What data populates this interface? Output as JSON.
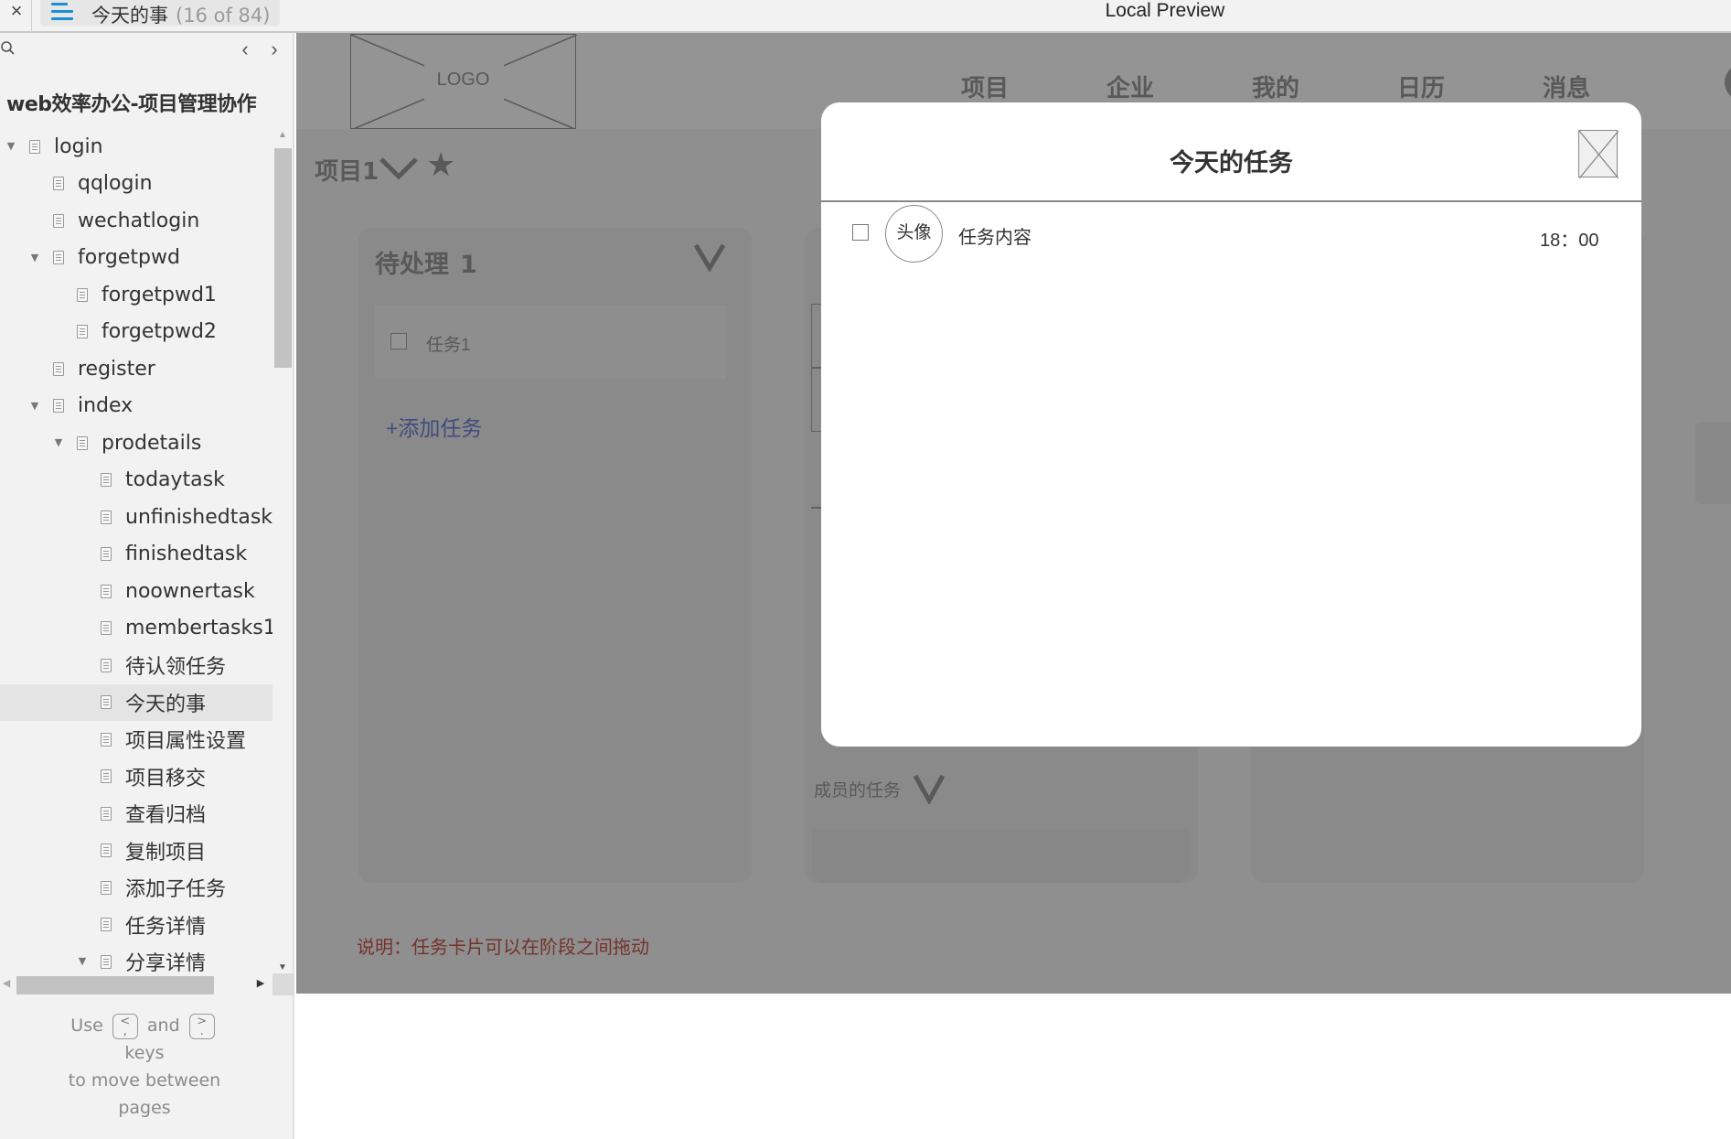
{
  "window": {
    "close_label": "×",
    "current_page": "今天的事",
    "page_count": "(16 of 84)",
    "title": "Local Preview"
  },
  "sidebar": {
    "project_title": "web效率办公-项目管理协作",
    "prev_label": "‹",
    "next_label": "›",
    "tree": [
      {
        "label": "login",
        "level": 0,
        "expanded": true
      },
      {
        "label": "qqlogin",
        "level": 1
      },
      {
        "label": "wechatlogin",
        "level": 1
      },
      {
        "label": "forgetpwd",
        "level": 1,
        "expanded": true
      },
      {
        "label": "forgetpwd1",
        "level": 2
      },
      {
        "label": "forgetpwd2",
        "level": 2
      },
      {
        "label": "register",
        "level": 1
      },
      {
        "label": "index",
        "level": 1,
        "expanded": true
      },
      {
        "label": "prodetails",
        "level": 2,
        "expanded": true
      },
      {
        "label": "todaytask",
        "level": 3
      },
      {
        "label": "unfinishedtask",
        "level": 3
      },
      {
        "label": "finishedtask",
        "level": 3
      },
      {
        "label": "noownertask",
        "level": 3
      },
      {
        "label": "membertasks1",
        "level": 3
      },
      {
        "label": "待认领任务",
        "level": 3
      },
      {
        "label": "今天的事",
        "level": 3,
        "selected": true
      },
      {
        "label": "项目属性设置",
        "level": 3
      },
      {
        "label": "项目移交",
        "level": 3
      },
      {
        "label": "查看归档",
        "level": 3
      },
      {
        "label": "复制项目",
        "level": 3
      },
      {
        "label": "添加子任务",
        "level": 3
      },
      {
        "label": "任务详情",
        "level": 3
      },
      {
        "label": "分享详情",
        "level": 3,
        "expanded": true
      }
    ],
    "hint": {
      "use": "Use",
      "key_prev_top": "<",
      "key_prev_bottom": ",",
      "and": "and",
      "key_next_top": ">",
      "key_next_bottom": ".",
      "keys": "keys",
      "line2": "to move between",
      "line3": "pages"
    }
  },
  "page": {
    "logo_text": "LOGO",
    "nav": [
      "项目",
      "企业",
      "我的",
      "日历",
      "消息"
    ],
    "project_name": "项目1",
    "columns": [
      {
        "title": "待处理",
        "count": "1",
        "tasks": [
          "任务1"
        ],
        "add_label": "+添加任务"
      }
    ],
    "member_tasks_label": "成员的任务",
    "note": "说明：任务卡片可以在阶段之间拖动"
  },
  "modal": {
    "title": "今天的任务",
    "tasks": [
      {
        "avatar": "头像",
        "content": "任务内容",
        "time": "18：00"
      }
    ]
  },
  "colors": {
    "accent_blue": "#1a8fd6",
    "add_link": "#6f83d6",
    "note_red": "#c8564a",
    "overlay": "rgba(0,0,0,0.42)"
  }
}
